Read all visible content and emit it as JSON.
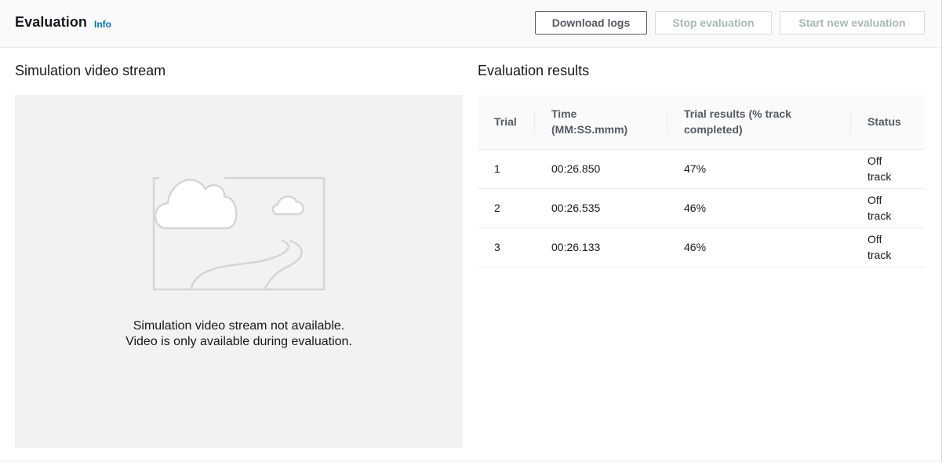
{
  "header": {
    "title": "Evaluation",
    "info_link": "Info",
    "buttons": {
      "download_logs": "Download logs",
      "stop_evaluation": "Stop evaluation",
      "start_new_evaluation": "Start new evaluation"
    }
  },
  "video": {
    "title": "Simulation video stream",
    "message_line1": "Simulation video stream not available.",
    "message_line2": "Video is only available during evaluation.",
    "illustration_icon": "image-placeholder-icon"
  },
  "results": {
    "title": "Evaluation results",
    "columns": [
      "Trial",
      "Time\n(MM:SS.mmm)",
      "Trial results (% track\ncompleted)",
      "Status"
    ],
    "column_lines": [
      [
        "Trial"
      ],
      [
        "Time",
        "(MM:SS.mmm)"
      ],
      [
        "Trial results (% track",
        "completed)"
      ],
      [
        "Status"
      ]
    ],
    "rows": [
      {
        "trial": "1",
        "time": "00:26.850",
        "result": "47%",
        "status": "Off track"
      },
      {
        "trial": "2",
        "time": "00:26.535",
        "result": "46%",
        "status": "Off track"
      },
      {
        "trial": "3",
        "time": "00:26.133",
        "result": "46%",
        "status": "Off track"
      }
    ]
  },
  "colors": {
    "header_bg": "#fafafa",
    "video_bg": "#f2f2f2",
    "link": "#0073bb",
    "text": "#16191f",
    "muted": "#545b64",
    "disabled": "#aab7b8"
  }
}
